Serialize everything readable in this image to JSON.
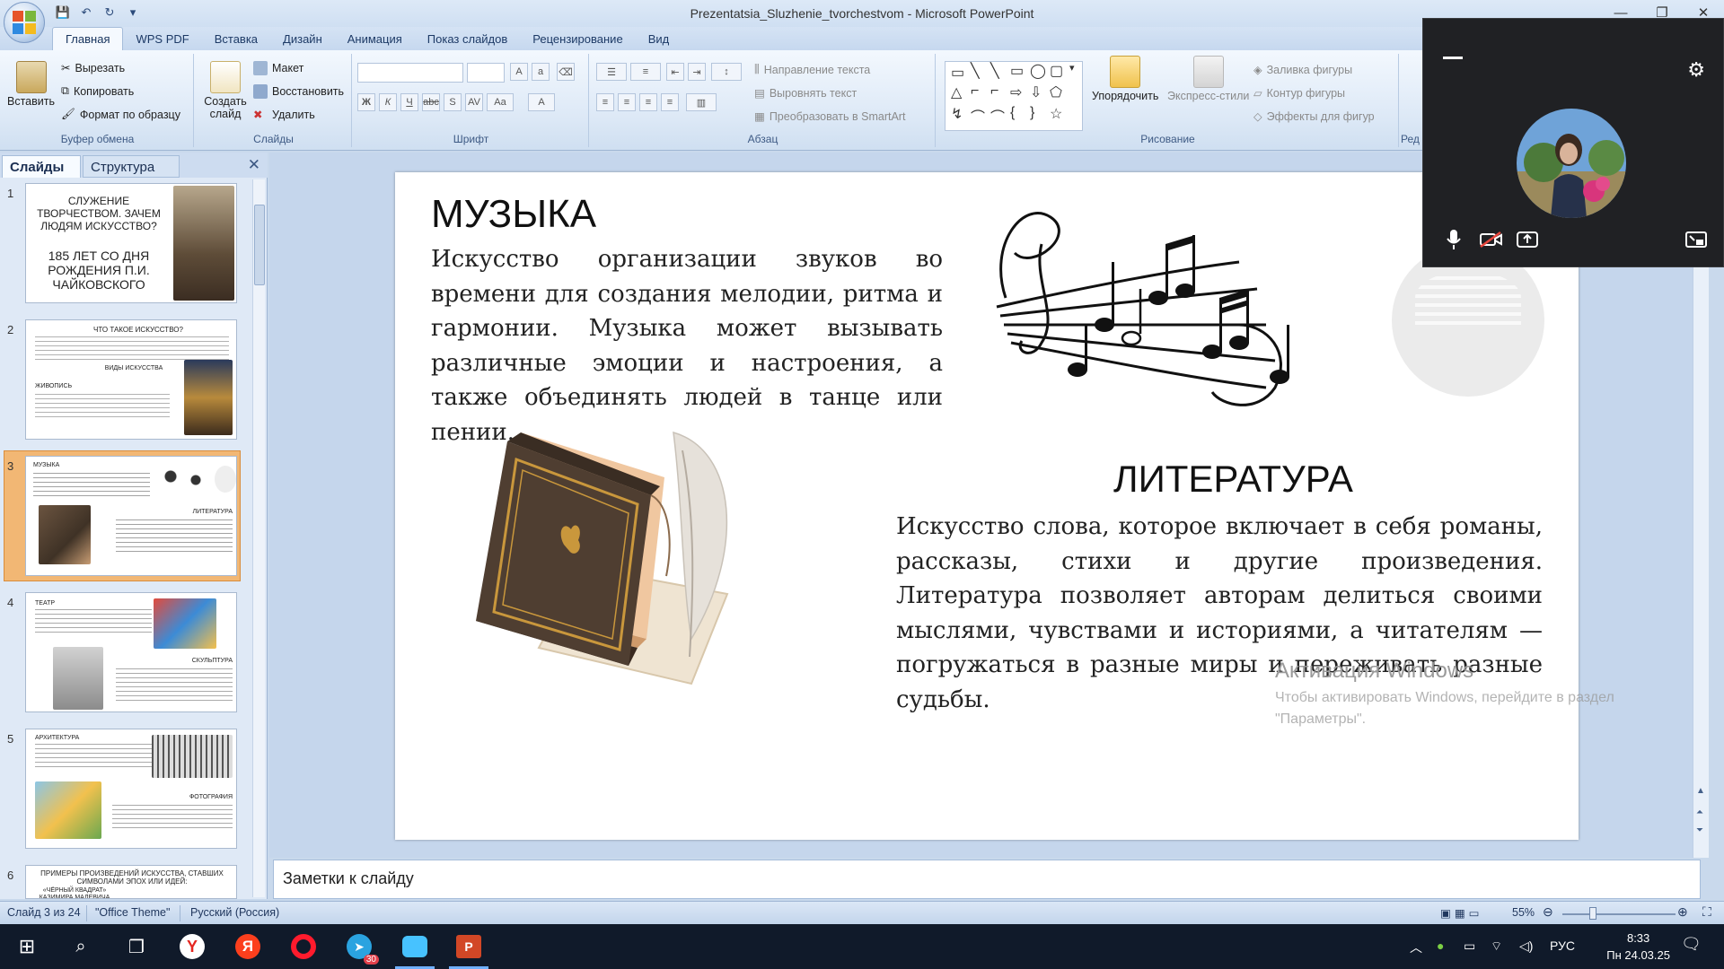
{
  "window": {
    "title": "Prezentatsia_Sluzhenie_tvorchestvom - Microsoft PowerPoint",
    "qat_save": "💾",
    "qat_undo": "↶",
    "qat_redo": "↻",
    "qat_more": "▾"
  },
  "ribbon_tabs": [
    "Главная",
    "WPS PDF",
    "Вставка",
    "Дизайн",
    "Анимация",
    "Показ слайдов",
    "Рецензирование",
    "Вид"
  ],
  "ribbon": {
    "clipboard": {
      "label": "Буфер обмена",
      "paste": "Вставить",
      "cut": "Вырезать",
      "copy": "Копировать",
      "format_painter": "Формат по образцу"
    },
    "slides": {
      "label": "Слайды",
      "new_slide": "Создать слайд",
      "layout": "Макет",
      "reset": "Восстановить",
      "delete": "Удалить"
    },
    "font": {
      "label": "Шрифт"
    },
    "paragraph": {
      "label": "Абзац",
      "text_direction": "Направление текста",
      "align_text": "Выровнять текст",
      "smartart": "Преобразовать в SmartArt"
    },
    "drawing": {
      "label": "Рисование",
      "arrange": "Упорядочить",
      "quick_styles": "Экспресс-стили",
      "shape_fill": "Заливка фигуры",
      "shape_outline": "Контур фигуры",
      "shape_effects": "Эффекты для фигур"
    },
    "editing_label": "Ред"
  },
  "left_pane": {
    "tab_slides": "Слайды",
    "tab_outline": "Структура",
    "close": "✕",
    "thumbnails": [
      {
        "num": "1",
        "title": "СЛУЖЕНИЕ ТВОРЧЕСТВОМ. ЗАЧЕМ ЛЮДЯМ ИСКУССТВО?",
        "subtitle": "185 ЛЕТ СО ДНЯ РОЖДЕНИЯ П.И. ЧАЙКОВСКОГО"
      },
      {
        "num": "2",
        "title": "ЧТО ТАКОЕ ИСКУССТВО?",
        "sub1": "ВИДЫ ИСКУССТВА",
        "sub2": "ЖИВОПИСЬ"
      },
      {
        "num": "3",
        "title": "МУЗЫКА",
        "sub1": "ЛИТЕРАТУРА"
      },
      {
        "num": "4",
        "title": "ТЕАТР",
        "sub1": "СКУЛЬПТУРА"
      },
      {
        "num": "5",
        "title": "АРХИТЕКТУРА",
        "sub1": "ФОТОГРАФИЯ"
      },
      {
        "num": "6",
        "title": "ПРИМЕРЫ ПРОИЗВЕДЕНИЙ ИСКУССТВА, СТАВШИХ СИМВОЛАМИ ЭПОХ ИЛИ ИДЕЙ:",
        "sub1": "«ЧЁРНЫЙ КВАДРАТ» КАЗИМИРА МАЛЕВИЧА"
      }
    ]
  },
  "slide": {
    "music_heading": "МУЗЫКА",
    "music_text": "Искусство организации звуков во времени для создания мелодии, ритма и гармонии. Музыка может вызывать различные эмоции и настроения, а также объединять людей в танце или пении.",
    "literature_heading": "ЛИТЕРАТУРА",
    "literature_text": "Искусство слова, которое включает в себя романы, рассказы, стихи и другие произведения. Литература позволяет авторам делиться своими мыслями, чувствами и историями, а читателям — погружаться в разные миры и переживать разные судьбы."
  },
  "watermark": {
    "title": "Активация Windows",
    "text": "Чтобы активировать Windows, перейдите в раздел \"Параметры\"."
  },
  "notes_placeholder": "Заметки к слайду",
  "status": {
    "slide_info": "Слайд 3 из 24",
    "theme": "\"Office Theme\"",
    "language": "Русский (Россия)",
    "zoom": "55%"
  },
  "taskbar": {
    "telegram_badge": "30",
    "language": "РУС",
    "time": "8:33",
    "date": "Пн 24.03.25"
  },
  "colors": {
    "accent": "#2b579a",
    "ribbon_bg": "#dce8f6",
    "selected_thumb": "#f2b774",
    "call_bg": "#202124"
  }
}
